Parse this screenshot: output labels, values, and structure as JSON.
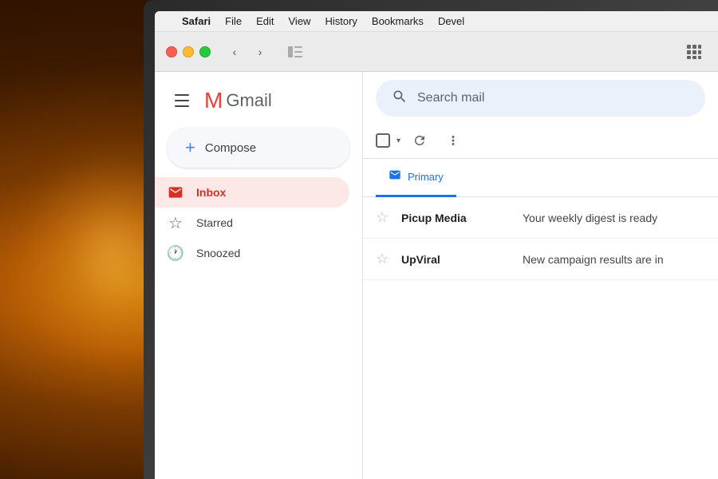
{
  "background": {
    "description": "bokeh background with warm orange light"
  },
  "menubar": {
    "apple_symbol": "",
    "items": [
      {
        "label": "Safari",
        "bold": true
      },
      {
        "label": "File",
        "bold": false
      },
      {
        "label": "Edit",
        "bold": false
      },
      {
        "label": "View",
        "bold": false
      },
      {
        "label": "History",
        "bold": false
      },
      {
        "label": "Bookmarks",
        "bold": false
      },
      {
        "label": "Devel",
        "bold": false
      }
    ]
  },
  "browser": {
    "back_arrow": "‹",
    "forward_arrow": "›",
    "sidebar_icon": "⬜",
    "grid_icon": "⠿"
  },
  "gmail": {
    "hamburger_label": "menu",
    "logo_m": "M",
    "logo_text": "Gmail",
    "compose_label": "Compose",
    "search_placeholder": "Search mail",
    "nav_items": [
      {
        "id": "inbox",
        "label": "Inbox",
        "icon": "📥",
        "active": true
      },
      {
        "id": "starred",
        "label": "Starred",
        "icon": "☆",
        "active": false
      },
      {
        "id": "snoozed",
        "label": "Snoozed",
        "icon": "🕐",
        "active": false
      }
    ],
    "tabs": [
      {
        "id": "primary",
        "label": "Primary",
        "icon": "📧",
        "active": true
      }
    ],
    "emails": [
      {
        "id": 1,
        "sender": "Picup Media",
        "subject": "Your weekly digest is ready",
        "starred": false
      },
      {
        "id": 2,
        "sender": "UpViral",
        "subject": "New campaign results are in",
        "starred": false
      }
    ]
  }
}
